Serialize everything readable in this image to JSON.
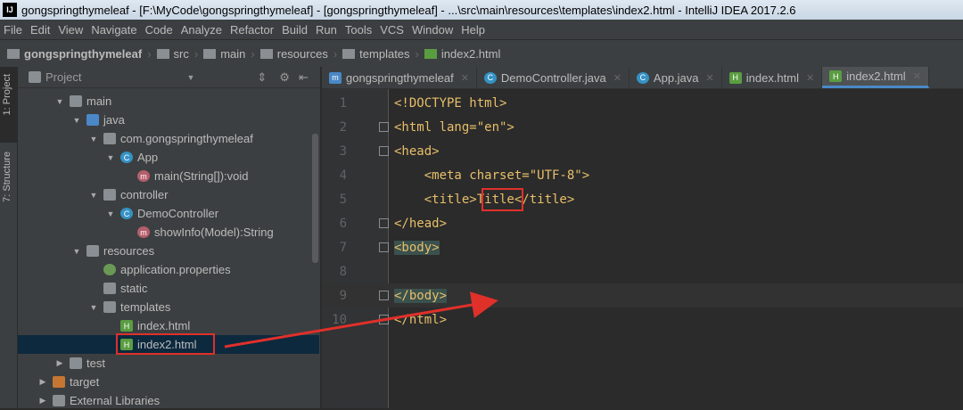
{
  "title": "gongspringthymeleaf - [F:\\MyCode\\gongspringthymeleaf] - [gongspringthymeleaf] - ...\\src\\main\\resources\\templates\\index2.html - IntelliJ IDEA 2017.2.6",
  "menu": [
    "File",
    "Edit",
    "View",
    "Navigate",
    "Code",
    "Analyze",
    "Refactor",
    "Build",
    "Run",
    "Tools",
    "VCS",
    "Window",
    "Help"
  ],
  "breadcrumb": [
    "gongspringthymeleaf",
    "src",
    "main",
    "resources",
    "templates",
    "index2.html"
  ],
  "side_tabs": [
    "1: Project",
    "7: Structure"
  ],
  "panel_title": "Project",
  "tree": [
    {
      "label": "main",
      "depth": 2,
      "icon": "folder",
      "arrow": "▼"
    },
    {
      "label": "java",
      "depth": 3,
      "icon": "source-folder",
      "arrow": "▼"
    },
    {
      "label": "com.gongspringthymeleaf",
      "depth": 4,
      "icon": "package",
      "arrow": "▼"
    },
    {
      "label": "App",
      "depth": 5,
      "icon": "class",
      "arrow": "▼"
    },
    {
      "label": "main(String[]):void",
      "depth": 6,
      "icon": "method",
      "arrow": ""
    },
    {
      "label": "controller",
      "depth": 4,
      "icon": "package",
      "arrow": "▼"
    },
    {
      "label": "DemoController",
      "depth": 5,
      "icon": "class",
      "arrow": "▼"
    },
    {
      "label": "showInfo(Model):String",
      "depth": 6,
      "icon": "method",
      "arrow": ""
    },
    {
      "label": "resources",
      "depth": 3,
      "icon": "folder",
      "arrow": "▼"
    },
    {
      "label": "application.properties",
      "depth": 4,
      "icon": "properties",
      "arrow": ""
    },
    {
      "label": "static",
      "depth": 4,
      "icon": "folder",
      "arrow": ""
    },
    {
      "label": "templates",
      "depth": 4,
      "icon": "folder",
      "arrow": "▼"
    },
    {
      "label": "index.html",
      "depth": 5,
      "icon": "html",
      "arrow": ""
    },
    {
      "label": "index2.html",
      "depth": 5,
      "icon": "html",
      "arrow": "",
      "selected": true
    },
    {
      "label": "test",
      "depth": 2,
      "icon": "folder",
      "arrow": "▶"
    },
    {
      "label": "target",
      "depth": 1,
      "icon": "excluded-folder",
      "arrow": "▶"
    },
    {
      "label": "External Libraries",
      "depth": 1,
      "icon": "libraries",
      "arrow": "▶"
    }
  ],
  "tabs": [
    {
      "label": "gongspringthymeleaf",
      "icon": "m"
    },
    {
      "label": "DemoController.java",
      "icon": "C"
    },
    {
      "label": "App.java",
      "icon": "C"
    },
    {
      "label": "index.html",
      "icon": "H"
    },
    {
      "label": "index2.html",
      "icon": "H",
      "active": true
    }
  ],
  "code_lines": [
    {
      "n": "1",
      "text": "<!DOCTYPE html>"
    },
    {
      "n": "2",
      "text": "<html lang=\"en\">"
    },
    {
      "n": "3",
      "text": "<head>"
    },
    {
      "n": "4",
      "text": "    <meta charset=\"UTF-8\">"
    },
    {
      "n": "5",
      "text": "    <title>Title</title>"
    },
    {
      "n": "6",
      "text": "</head>"
    },
    {
      "n": "7",
      "text": "<body>"
    },
    {
      "n": "8",
      "text": ""
    },
    {
      "n": "9",
      "text": "</body>"
    },
    {
      "n": "10",
      "text": "</html>"
    }
  ],
  "annotation_color": "#e0302a"
}
